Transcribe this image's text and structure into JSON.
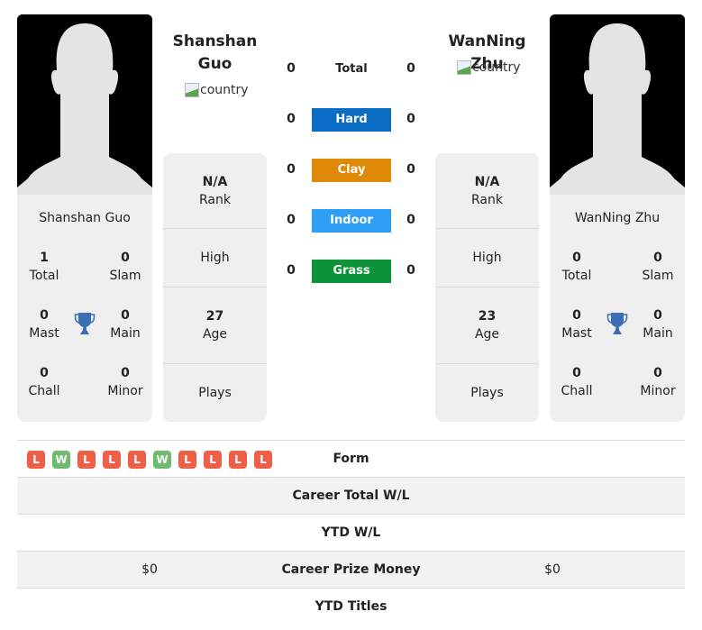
{
  "player1": {
    "name": "Shanshan Guo",
    "flag_alt": "country",
    "rank": "N/A",
    "rank_label": "Rank",
    "high_label": "High",
    "age": "27",
    "age_label": "Age",
    "plays_label": "Plays",
    "titles": {
      "total": "1",
      "total_label": "Total",
      "slam": "0",
      "slam_label": "Slam",
      "mast": "0",
      "mast_label": "Mast",
      "main": "0",
      "main_label": "Main",
      "chall": "0",
      "chall_label": "Chall",
      "minor": "0",
      "minor_label": "Minor"
    }
  },
  "player2": {
    "name": "WanNing Zhu",
    "flag_alt": "country",
    "rank": "N/A",
    "rank_label": "Rank",
    "high_label": "High",
    "age": "23",
    "age_label": "Age",
    "plays_label": "Plays",
    "titles": {
      "total": "0",
      "total_label": "Total",
      "slam": "0",
      "slam_label": "Slam",
      "mast": "0",
      "mast_label": "Mast",
      "main": "0",
      "main_label": "Main",
      "chall": "0",
      "chall_label": "Chall",
      "minor": "0",
      "minor_label": "Minor"
    }
  },
  "surfaces": [
    {
      "label": "Total",
      "left": "0",
      "right": "0",
      "color": ""
    },
    {
      "label": "Hard",
      "left": "0",
      "right": "0",
      "color": "#0a6cc2"
    },
    {
      "label": "Clay",
      "left": "0",
      "right": "0",
      "color": "#de8a06"
    },
    {
      "label": "Indoor",
      "left": "0",
      "right": "0",
      "color": "#2f9ef5"
    },
    {
      "label": "Grass",
      "left": "0",
      "right": "0",
      "color": "#0e9438"
    }
  ],
  "form": [
    "L",
    "W",
    "L",
    "L",
    "L",
    "W",
    "L",
    "L",
    "L",
    "L"
  ],
  "table": {
    "form_label": "Form",
    "career_wl_label": "Career Total W/L",
    "ytd_wl_label": "YTD W/L",
    "prize_label": "Career Prize Money",
    "prize_left": "$0",
    "prize_right": "$0",
    "ytd_titles_label": "YTD Titles"
  },
  "colors": {
    "loss": "#ee5f48",
    "win": "#6dbb6d",
    "trophy": "#3a6fb5"
  }
}
